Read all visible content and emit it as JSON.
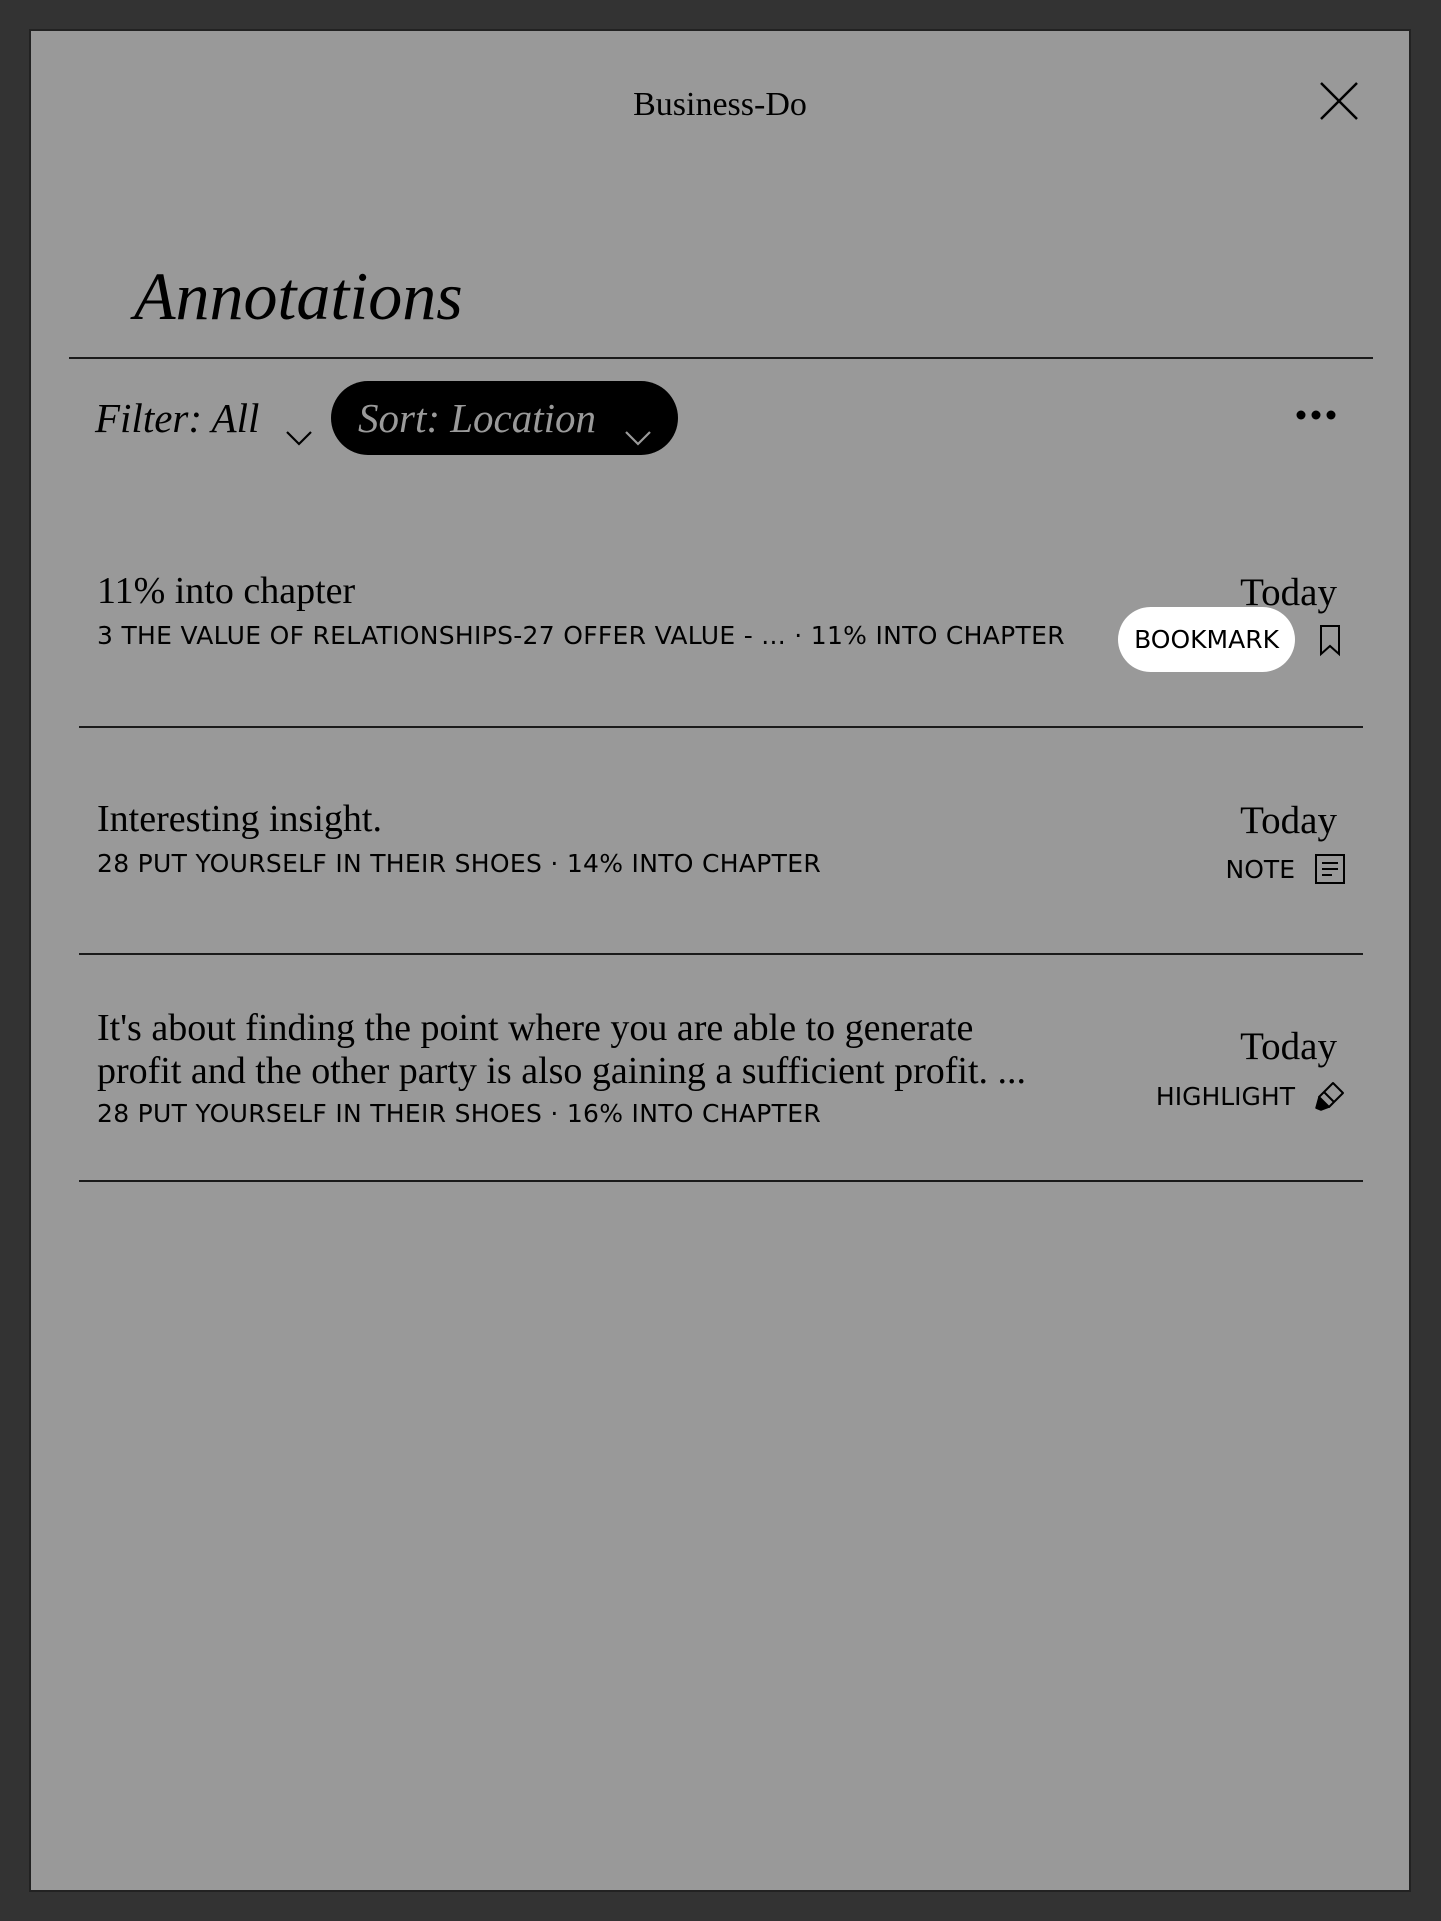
{
  "header": {
    "book_title": "Business-Do",
    "close_icon": "close-icon"
  },
  "heading": "Annotations",
  "toolbar": {
    "filter_label": "Filter: All",
    "sort_label": "Sort: Location",
    "more_icon": "more-horizontal-icon"
  },
  "annotations": [
    {
      "text": "11% into chapter",
      "meta": "3 THE VALUE OF RELATIONSHIPS-27  OFFER VALUE - ... · 11% INTO CHAPTER",
      "date": "Today",
      "type": "BOOKMARK",
      "icon": "bookmark-icon"
    },
    {
      "text": "Interesting insight.",
      "meta": "28  PUT YOURSELF IN THEIR SHOES · 14% INTO CHAPTER",
      "date": "Today",
      "type": "NOTE",
      "icon": "note-icon"
    },
    {
      "text_line1": "It's about finding the point where you are able to generate",
      "text_line2": "profit and the other party is also gaining a sufficient profit. ...",
      "meta": "28  PUT YOURSELF IN THEIR SHOES · 16% INTO CHAPTER",
      "date": "Today",
      "type": "HIGHLIGHT",
      "icon": "highlighter-icon"
    }
  ]
}
